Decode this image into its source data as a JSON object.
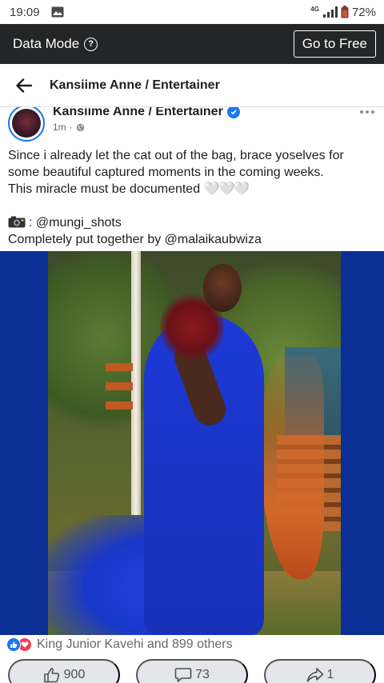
{
  "status_bar": {
    "time": "19:09",
    "network": "4G",
    "battery": "72%",
    "icons": [
      "gallery-icon",
      "signal-icon",
      "battery-icon"
    ]
  },
  "data_bar": {
    "label": "Data Mode",
    "help_symbol": "?",
    "cta": "Go to Free"
  },
  "header": {
    "title": "Kansiime Anne / Entertainer"
  },
  "post": {
    "author": "Kansiime Anne / Entertainer",
    "time": "1m",
    "separator": "·",
    "text_lines": [
      "Since i already let the cat out of the bag, brace yoselves for",
      "some beautiful captured moments in the coming weeks.",
      "This miracle must be documented"
    ],
    "hearts": "🤍🤍🤍",
    "credit_photo": "@mungi_shots",
    "credit_line": "Completely put together by @malaikaubwiza"
  },
  "reactions": {
    "summary": "King Junior Kavehi and 899 others",
    "icons": [
      "like-icon",
      "love-icon"
    ]
  },
  "actions": {
    "like_count": "900",
    "comment_count": "73",
    "share_count": "1"
  },
  "colors": {
    "dark_bar": "#242526",
    "accent": "#1877f2",
    "love": "#f33e58",
    "photo_bg": "#0b2f94",
    "button_bg": "#e4e6eb"
  }
}
